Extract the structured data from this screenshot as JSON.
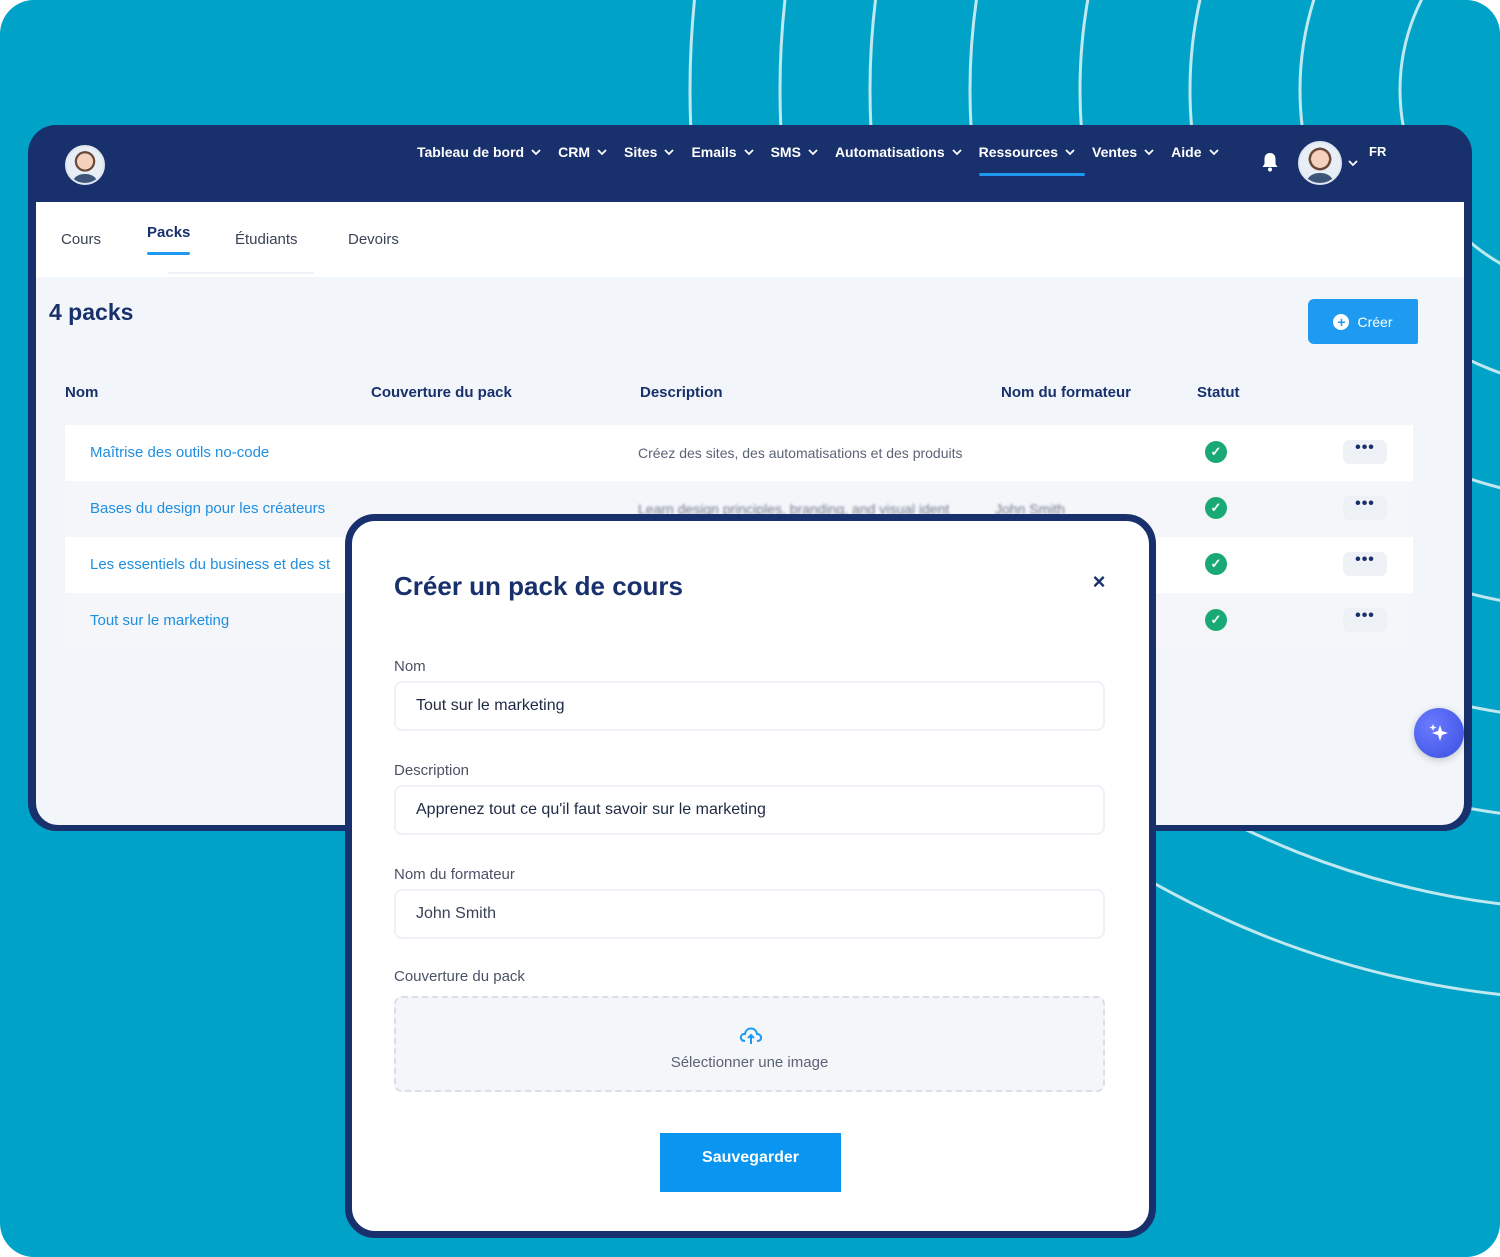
{
  "nav": {
    "items": [
      {
        "label": "Tableau de bord",
        "active": false
      },
      {
        "label": "CRM",
        "active": false
      },
      {
        "label": "Sites",
        "active": false
      },
      {
        "label": "Emails",
        "active": false
      },
      {
        "label": "SMS",
        "active": false
      },
      {
        "label": "Automatisations",
        "active": false
      },
      {
        "label": "Ressources",
        "active": true
      },
      {
        "label": "Ventes",
        "active": false
      },
      {
        "label": "Aide",
        "active": false
      }
    ],
    "language": "FR",
    "icons": {
      "bell": "bell-icon",
      "chevron": "chevron-down-icon"
    }
  },
  "tabs": [
    {
      "label": "Cours",
      "active": false
    },
    {
      "label": "Packs",
      "active": true
    },
    {
      "label": "Étudiants",
      "active": false
    },
    {
      "label": "Devoirs",
      "active": false
    }
  ],
  "packs": {
    "heading": "4 packs",
    "create_label": "Créer",
    "columns": {
      "name": "Nom",
      "cover": "Couverture du pack",
      "description": "Description",
      "trainer": "Nom du formateur",
      "status": "Statut"
    },
    "rows": [
      {
        "name": "Maîtrise des outils no-code",
        "description": "Créez des sites, des automatisations et des produits",
        "trainer": "",
        "status": "active",
        "more": "•••"
      },
      {
        "name": "Bases du design pour les créateurs",
        "description": "Learn design principles, branding, and visual ident",
        "trainer": "John Smith",
        "status": "active",
        "more": "•••"
      },
      {
        "name": "Les essentiels du business et des st",
        "description": "",
        "trainer": "",
        "status": "active",
        "more": "•••"
      },
      {
        "name": "Tout sur le marketing",
        "description": "",
        "trainer": "",
        "status": "active",
        "more": "•••"
      }
    ]
  },
  "modal": {
    "title": "Créer un pack de cours",
    "close_label": "×",
    "name_label": "Nom",
    "name_value": "Tout sur le marketing",
    "description_label": "Description",
    "description_value": "Apprenez tout ce qu'il faut savoir sur le marketing",
    "trainer_label": "Nom du formateur",
    "trainer_value": "John Smith",
    "cover_label": "Couverture du pack",
    "upload_label": "Sélectionner une image",
    "save_label": "Sauvegarder"
  },
  "colors": {
    "background": "#00a3c7",
    "navy": "#18306b",
    "accent": "#1e9bf0",
    "status_green": "#19a974"
  }
}
